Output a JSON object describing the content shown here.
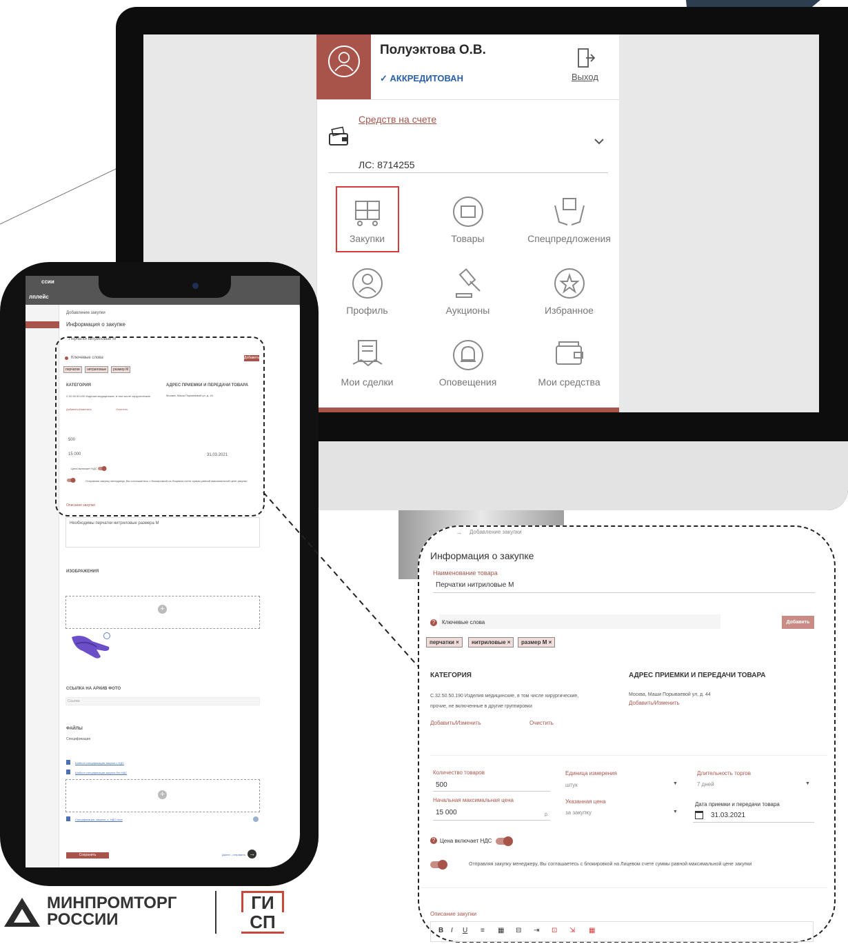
{
  "profile": {
    "user_name": "Полуэктова О.В.",
    "status": "✓ АККРЕДИТОВАН",
    "exit_label": "Выход",
    "funds_link": "Средств на счете",
    "account": "ЛС: 8714255"
  },
  "menu": [
    {
      "label": "Закупки",
      "icon": "cart-icon",
      "selected": true
    },
    {
      "label": "Товары",
      "icon": "product-box-icon"
    },
    {
      "label": "Спецпредложения",
      "icon": "hands-box-icon"
    },
    {
      "label": "Профиль",
      "icon": "profile-icon"
    },
    {
      "label": "Аукционы",
      "icon": "gavel-icon"
    },
    {
      "label": "Избранное",
      "icon": "star-icon"
    },
    {
      "label": "Мои сделки",
      "icon": "handshake-doc-icon"
    },
    {
      "label": "Оповещения",
      "icon": "bell-icon"
    },
    {
      "label": "Мои средства",
      "icon": "wallet-icon"
    }
  ],
  "form": {
    "breadcrumb_sep": "→",
    "breadcrumb": "Добавление закупки",
    "title": "Информация о закупке",
    "product_name_label": "Наименование товара",
    "product_name": "Перчатки нитриловые М",
    "keywords_placeholder": "Ключевые слова",
    "add_button": "Добавить",
    "chips": [
      "перчатки",
      "нитриловые",
      "размер М"
    ],
    "category_heading": "КАТЕГОРИЯ",
    "category_text_1": "С.32.50.50.190 Изделия медицинские, в том числе хирургические,",
    "category_text_2": "прочие, не включенные в другие группировки",
    "category_edit": "Добавить/Изменить",
    "category_clear": "Очистить",
    "address_heading": "АДРЕС ПРИЕМКИ И ПЕРЕДАЧИ ТОВАРА",
    "address_text": "Москва, Маши Порываевой ул, д. 44",
    "address_edit": "Добавить/Изменить",
    "qty_label": "Количество товаров",
    "qty_value": "500",
    "unit_label": "Единица измерения",
    "unit_value": "штук",
    "duration_label": "Длительность торгов",
    "duration_value": "7 дней",
    "max_price_label": "Начальная максимальная цена",
    "max_price_value": "15 000",
    "currency": "р.",
    "price_type_label": "Указанная цена",
    "price_type_value": "за закупку",
    "date_label": "Дата приемки и передачи товара",
    "date_value": "31.03.2021",
    "vat_label": "Цена включает НДС",
    "agreement_text": "Отправляя закупку менеджеру, Вы соглашаетесь с блокировкой на Лицевом счете суммы равной максимальной цене закупки",
    "description_label": "Описание закупки",
    "toolbar": [
      "B",
      "I",
      "U",
      "≡",
      "▦",
      "⊟",
      "⇥",
      "⊡",
      "⇲",
      "▦"
    ],
    "description_text": "Необходимы перчатки нитриловые размера М",
    "images_heading": "ИЗОБРАЖЕНИЯ",
    "archive_heading": "ССЫЛКА НА АРХИВ ФОТО",
    "archive_placeholder": "Ссылка",
    "files_heading": "ФАЙЛЫ",
    "spec_label": "Спецификация",
    "file_1": "Шаблон спецификации закупки с НДС",
    "file_2": "Шаблон спецификации закупки без НДС",
    "file_uploaded": "Спецификация_закупки_с_НДС.docx",
    "save_button": "Сохранить",
    "send_link": "Далее - отправить"
  },
  "phone_sidebar": {
    "top_text": "ссии",
    "side_text": "лплейс"
  },
  "logos": {
    "ministry_line_1": "МИНПРОМТОРГ",
    "ministry_line_2": "РОССИИ",
    "gisp_line_1": "ГИ",
    "gisp_line_2": "СП"
  },
  "colors": {
    "accent": "#a8544a",
    "status_blue": "#2a5fa8",
    "highlight_red": "#d63a3a",
    "yellow": "#f2b705"
  }
}
